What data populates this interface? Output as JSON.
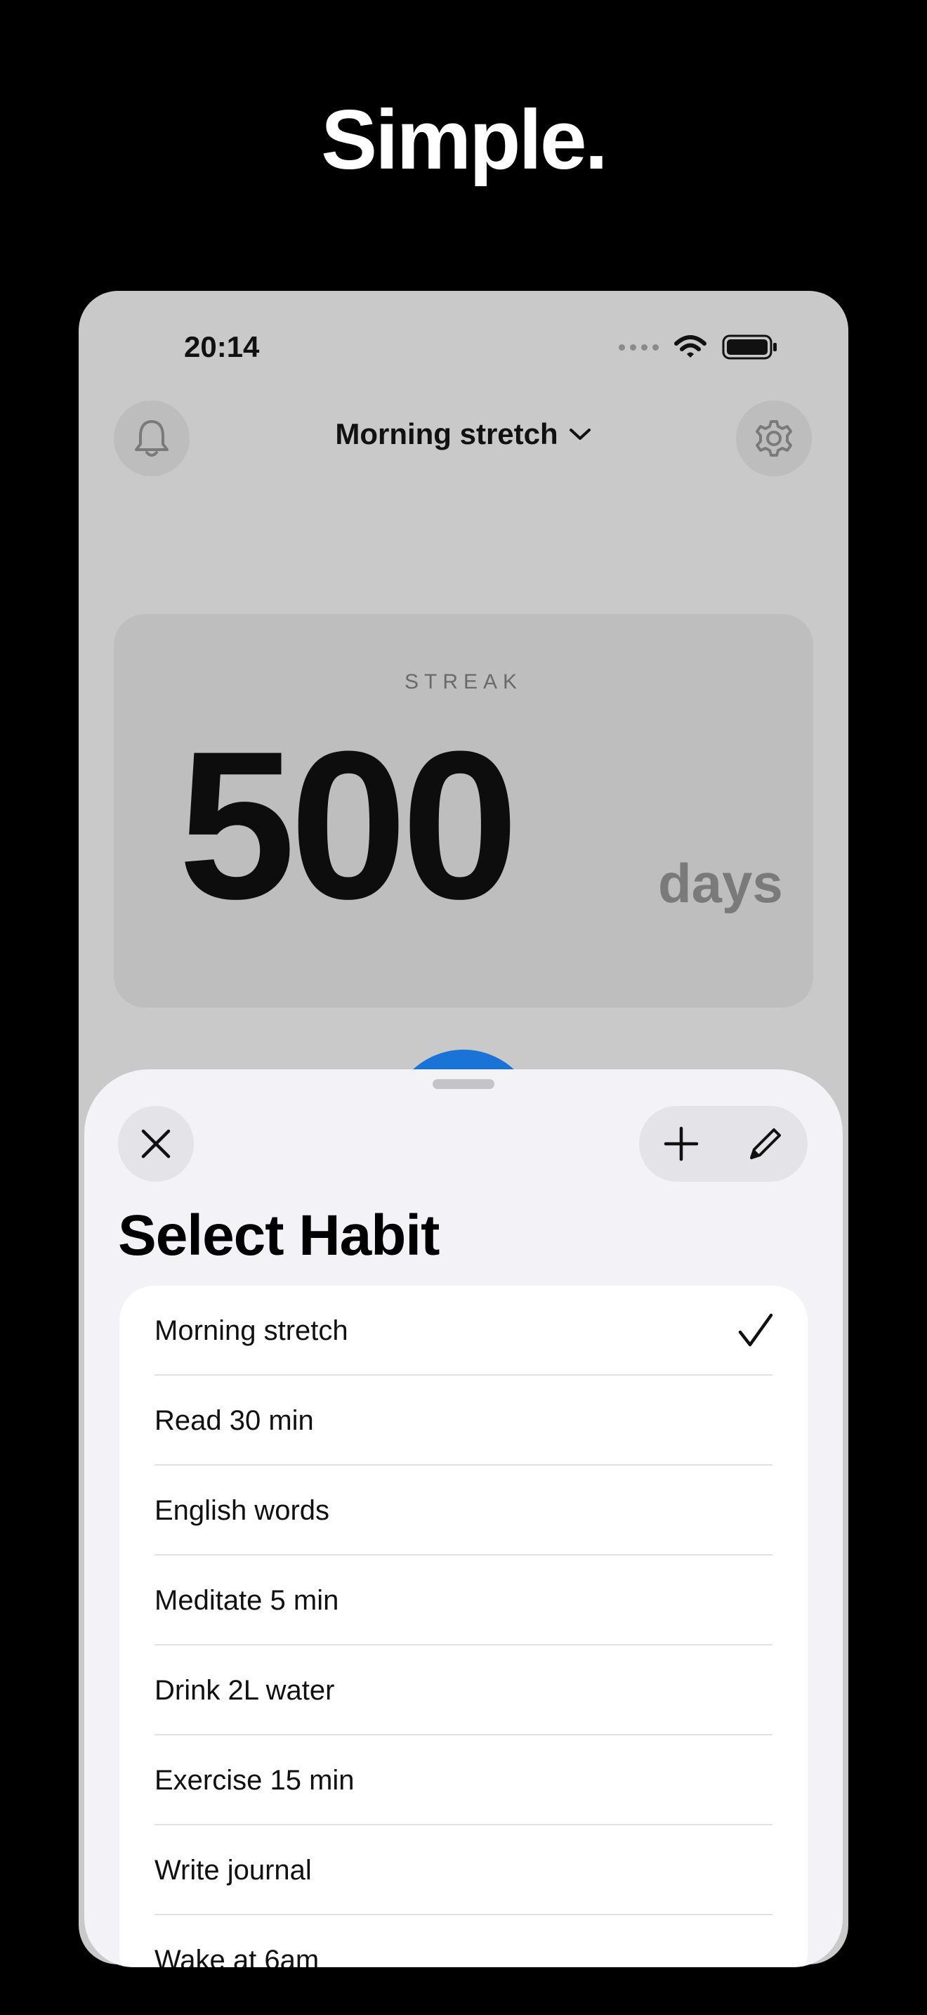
{
  "headline": "Simple.",
  "status": {
    "time": "20:14"
  },
  "header": {
    "habit_title": "Morning stretch"
  },
  "streak": {
    "label": "STREAK",
    "value": "500",
    "unit": "days"
  },
  "sheet": {
    "title": "Select Habit",
    "items": [
      {
        "label": "Morning stretch",
        "selected": true
      },
      {
        "label": "Read 30 min",
        "selected": false
      },
      {
        "label": "English words",
        "selected": false
      },
      {
        "label": "Meditate 5 min",
        "selected": false
      },
      {
        "label": "Drink 2L water",
        "selected": false
      },
      {
        "label": "Exercise 15 min",
        "selected": false
      },
      {
        "label": "Write journal",
        "selected": false
      },
      {
        "label": "Wake at 6am",
        "selected": false
      }
    ]
  },
  "icons": [
    "bell-icon",
    "settings-icon",
    "chevron-down-icon",
    "close-icon",
    "plus-icon",
    "pencil-icon",
    "checkmark-icon",
    "wifi-icon",
    "battery-icon",
    "cellular-dots-icon"
  ],
  "colors": {
    "accent": "#1a73d6",
    "background": "#000000",
    "sheet": "#f2f2f7"
  }
}
